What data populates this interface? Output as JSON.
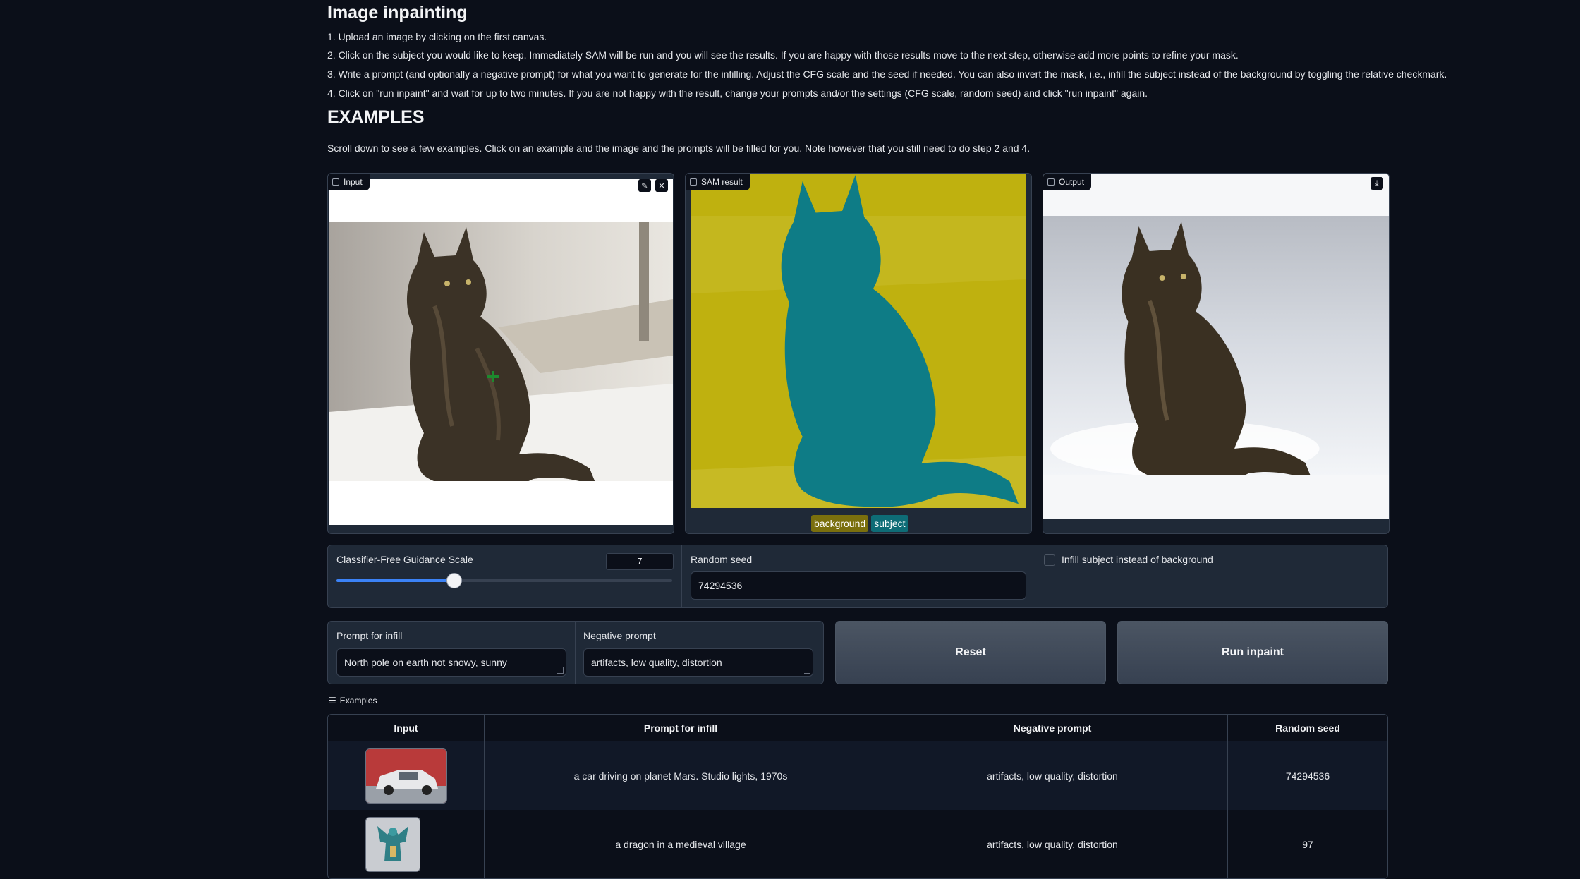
{
  "page": {
    "title": "Image inpainting",
    "steps": [
      "1. Upload an image by clicking on the first canvas.",
      "2. Click on the subject you would like to keep. Immediately SAM will be run and you will see the results. If you are happy with those results move to the next step, otherwise add more points to refine your mask.",
      "3. Write a prompt (and optionally a negative prompt) for what you want to generate for the infilling. Adjust the CFG scale and the seed if needed. You can also invert the mask, i.e., infill the subject instead of the background by toggling the relative checkmark.",
      "4. Click on \"run inpaint\" and wait for up to two minutes. If you are not happy with the result, change your prompts and/or the settings (CFG scale, random seed) and click \"run inpaint\" again."
    ],
    "examples_heading": "EXAMPLES",
    "examples_note": "Scroll down to see a few examples. Click on an example and the image and the prompts will be filled for you. Note however that you still need to do step 2 and 4."
  },
  "panels": {
    "input_label": "Input",
    "sam_label": "SAM result",
    "output_label": "Output",
    "legend": [
      "background",
      "subject"
    ]
  },
  "controls": {
    "cfg_label": "Classifier-Free Guidance Scale",
    "cfg_value": "7",
    "cfg_fraction": 0.35,
    "seed_label": "Random seed",
    "seed_value": "74294536",
    "infill_checkbox_label": "Infill subject instead of background",
    "prompt_label": "Prompt for infill",
    "prompt_value": "North pole on earth not snowy, sunny",
    "negative_label": "Negative prompt",
    "negative_value": "artifacts, low quality, distortion",
    "reset_label": "Reset",
    "run_label": "Run inpaint"
  },
  "examples": {
    "label": "Examples",
    "headers": [
      "Input",
      "Prompt for infill",
      "Negative prompt",
      "Random seed"
    ],
    "rows": [
      {
        "prompt": "a car driving on planet Mars. Studio lights, 1970s",
        "negative": "artifacts, low quality, distortion",
        "seed": "74294536"
      },
      {
        "prompt": "a dragon in a medieval village",
        "negative": "artifacts, low quality, distortion",
        "seed": "97"
      }
    ]
  },
  "colors": {
    "background": "#0b0f19",
    "panel": "#1f2937",
    "accent": "#3b82f6",
    "mask_background": "#bfb10f",
    "mask_subject": "#0e7c86"
  }
}
